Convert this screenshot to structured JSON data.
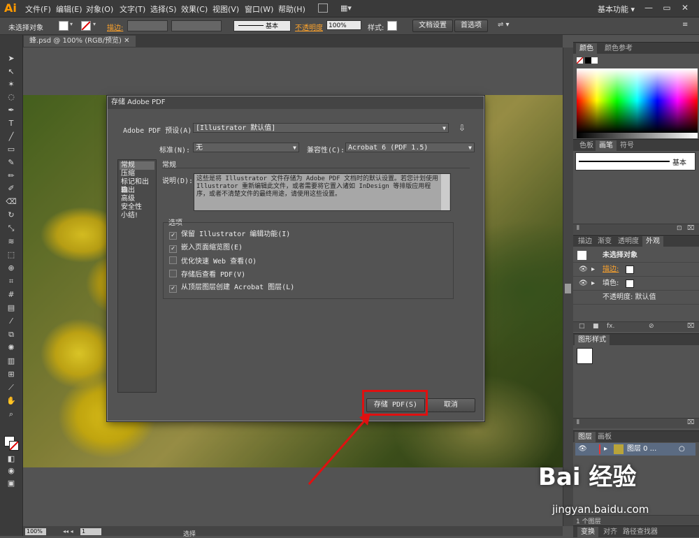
{
  "app": {
    "logo": "Ai",
    "menu": [
      "文件(F)",
      "编辑(E)",
      "对象(O)",
      "文字(T)",
      "选择(S)",
      "效果(C)",
      "视图(V)",
      "窗口(W)",
      "帮助(H)"
    ],
    "workspace": "基本功能",
    "colors": {
      "accent": "#ff9a00",
      "highlight": "#e01010"
    }
  },
  "control": {
    "selection": "未选择对象",
    "stroke_label": "描边:",
    "stroke_style": "基本",
    "opacity_label": "不透明度",
    "opacity": "100%",
    "style_label": "样式:",
    "doc_setup": "文档设置",
    "prefs": "首选项"
  },
  "document": {
    "tab": "蜂.psd @ 100% (RGB/预览)",
    "zoom": "100%",
    "page": "1",
    "status": "选择"
  },
  "dialog": {
    "title": "存储 Adobe PDF",
    "preset_label": "Adobe PDF 预设(A):",
    "preset_value": "[Illustrator 默认值]",
    "standard_label": "标准(N):",
    "standard_value": "无",
    "compat_label": "兼容性(C):",
    "compat_value": "Acrobat 6 (PDF 1.5)",
    "nav": [
      "常规",
      "压缩",
      "标记和出血",
      "输出",
      "高级",
      "安全性",
      "小结!"
    ],
    "section_title": "常规",
    "desc_label": "说明(D):",
    "description": "这些是将 Illustrator 文件存储为 Adobe PDF 文档时的默认设置。若您计划使用 Illustrator 重新编辑此文件，或者需要将它置入诸如 InDesign 等排版应用程序，或者不清楚文件的最终用途，请使用这些设置。",
    "options_title": "选项",
    "options": [
      {
        "label": "保留 Illustrator 编辑功能(I)",
        "checked": true
      },
      {
        "label": "嵌入页面缩览图(E)",
        "checked": true
      },
      {
        "label": "优化快速 Web 查看(O)",
        "checked": false
      },
      {
        "label": "存储后查看 PDF(V)",
        "checked": false
      },
      {
        "label": "从顶层图层创建 Acrobat 图层(L)",
        "checked": true
      }
    ],
    "save_btn": "存储 PDF(S)",
    "cancel_btn": "取消"
  },
  "panels": {
    "color_tabs": [
      "颜色",
      "颜色参考"
    ],
    "brush_tabs": [
      "色板",
      "画笔",
      "符号"
    ],
    "brush_name": "基本",
    "appearance_tabs": [
      "描边",
      "渐变",
      "透明度",
      "外观"
    ],
    "appearance_title": "未选择对象",
    "appearance_rows": [
      "描边:",
      "填色:",
      "不透明度: 默认值"
    ],
    "graphic_styles": "图形样式",
    "layer_tabs": [
      "图层",
      "画板"
    ],
    "layer_name": "图层 0 ...",
    "layer_count": "1 个图层",
    "bottom_tabs": [
      "变换",
      "对齐",
      "路径查找器"
    ]
  },
  "watermark": {
    "brand": "Bai 经验",
    "url": "jingyan.baidu.com"
  }
}
